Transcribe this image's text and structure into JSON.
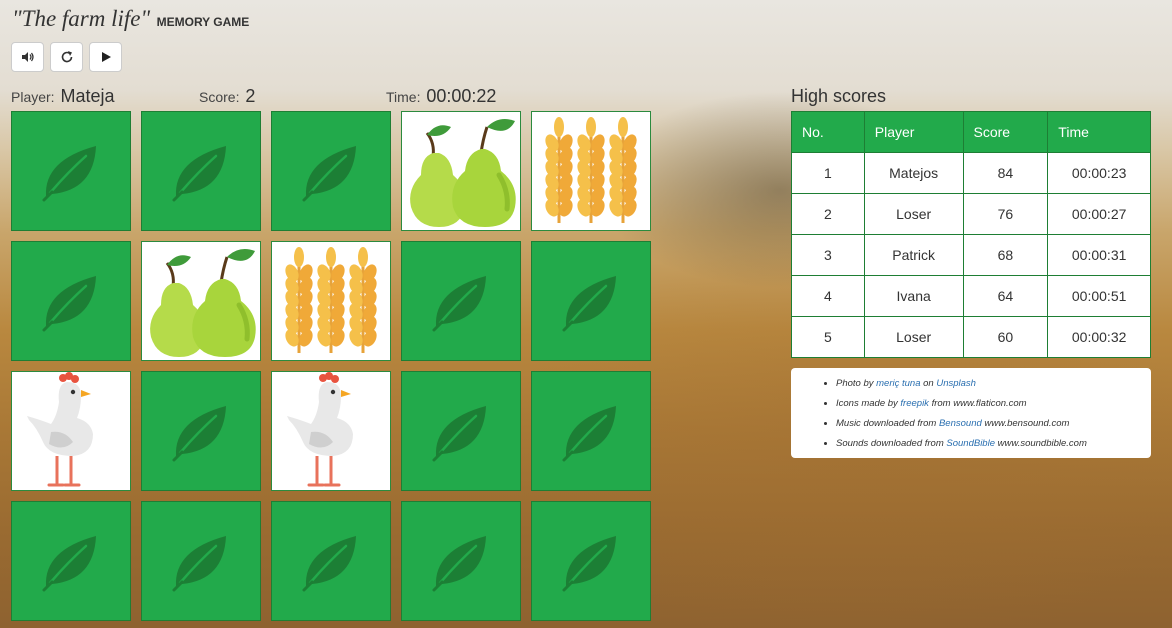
{
  "header": {
    "title": "\"The farm life\"",
    "subtitle": "MEMORY GAME"
  },
  "controls": [
    {
      "name": "sound-button",
      "icon": "speaker-icon"
    },
    {
      "name": "restart-button",
      "icon": "refresh-icon"
    },
    {
      "name": "play-button",
      "icon": "play-icon"
    }
  ],
  "status": {
    "player_label": "Player:",
    "player_value": "Mateja",
    "score_label": "Score:",
    "score_value": "2",
    "time_label": "Time:",
    "time_value": "00:00:22"
  },
  "board": {
    "cards": [
      "back",
      "back",
      "back",
      "pears",
      "wheat",
      "back",
      "pears",
      "wheat",
      "back",
      "back",
      "chicken",
      "back",
      "chicken",
      "back",
      "back",
      "back",
      "back",
      "back",
      "back",
      "back"
    ]
  },
  "high_scores": {
    "title": "High scores",
    "columns": [
      "No.",
      "Player",
      "Score",
      "Time"
    ],
    "rows": [
      [
        "1",
        "Matejos",
        "84",
        "00:00:23"
      ],
      [
        "2",
        "Loser",
        "76",
        "00:00:27"
      ],
      [
        "3",
        "Patrick",
        "68",
        "00:00:31"
      ],
      [
        "4",
        "Ivana",
        "64",
        "00:00:51"
      ],
      [
        "5",
        "Loser",
        "60",
        "00:00:32"
      ]
    ]
  },
  "credits": {
    "photo_pre": "Photo by ",
    "photo_link": "meriç tuna",
    "photo_mid": " on ",
    "photo_link2": "Unsplash",
    "icons_pre": "Icons made by ",
    "icons_link": "freepik",
    "icons_post": " from www.flaticon.com",
    "music_pre": "Music downloaded from ",
    "music_link": "Bensound",
    "music_post": " www.bensound.com",
    "sounds_pre": "Sounds downloaded from ",
    "sounds_link": "SoundBible",
    "sounds_post": " www.soundbible.com"
  },
  "colors": {
    "card_back": "#22aa4b",
    "leaf": "#1c7f35",
    "table_header": "#22aa4b"
  }
}
